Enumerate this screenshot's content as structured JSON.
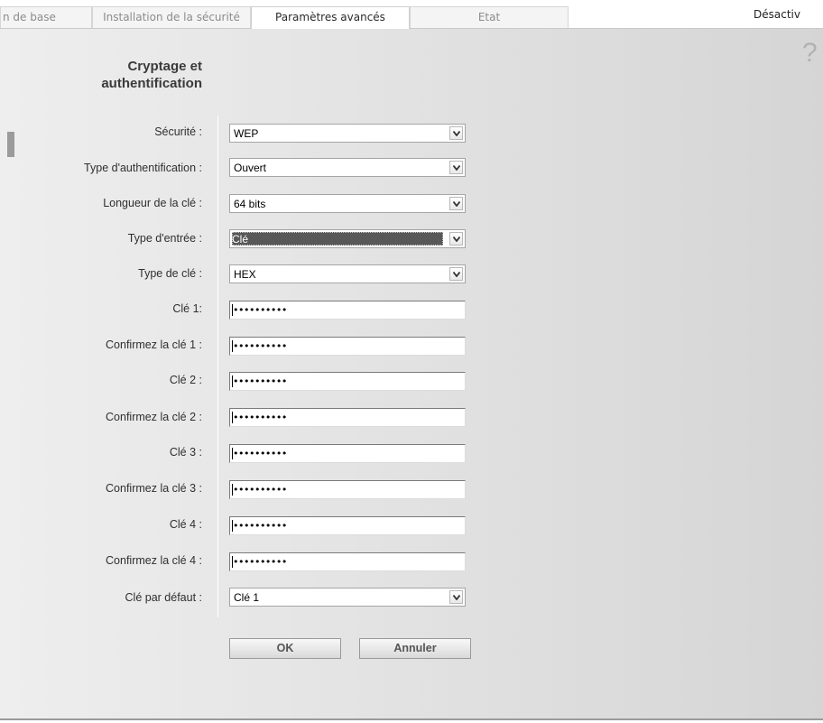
{
  "tabs": [
    {
      "label": "n de base"
    },
    {
      "label": "Installation de la sécurité"
    },
    {
      "label": "Paramètres avancés"
    },
    {
      "label": "Etat"
    }
  ],
  "header_right": "Désactiv",
  "help_icon": "?",
  "section": {
    "title": "Cryptage et authentification"
  },
  "form": {
    "security": {
      "label": "Sécurité :",
      "value": "WEP"
    },
    "auth_type": {
      "label": "Type d'authentification :",
      "value": "Ouvert"
    },
    "key_length": {
      "label": "Longueur de la clé :",
      "value": "64 bits"
    },
    "input_type": {
      "label": "Type d'entrée :",
      "value": "Clé"
    },
    "key_type": {
      "label": "Type de clé :",
      "value": "HEX"
    },
    "key1": {
      "label": "Clé 1:",
      "value": "••••••••••"
    },
    "key1_confirm": {
      "label": "Confirmez la clé 1 :",
      "value": "••••••••••"
    },
    "key2": {
      "label": "Clé 2 :",
      "value": "••••••••••"
    },
    "key2_confirm": {
      "label": "Confirmez la clé 2 :",
      "value": "••••••••••"
    },
    "key3": {
      "label": "Clé 3 :",
      "value": "••••••••••"
    },
    "key3_confirm": {
      "label": "Confirmez la clé 3 :",
      "value": "••••••••••"
    },
    "key4": {
      "label": "Clé 4 :",
      "value": "••••••••••"
    },
    "key4_confirm": {
      "label": "Confirmez la clé 4 :",
      "value": "••••••••••"
    },
    "default_key": {
      "label": "Clé par défaut :",
      "value": "Clé 1"
    }
  },
  "buttons": {
    "ok": "OK",
    "cancel": "Annuler"
  },
  "colors": {
    "panel_gradient_start": "#eeeeee",
    "panel_gradient_end": "#d5d5d5",
    "selection": "#585858"
  },
  "icons": [
    "chevron-down-icon",
    "help-icon"
  ]
}
